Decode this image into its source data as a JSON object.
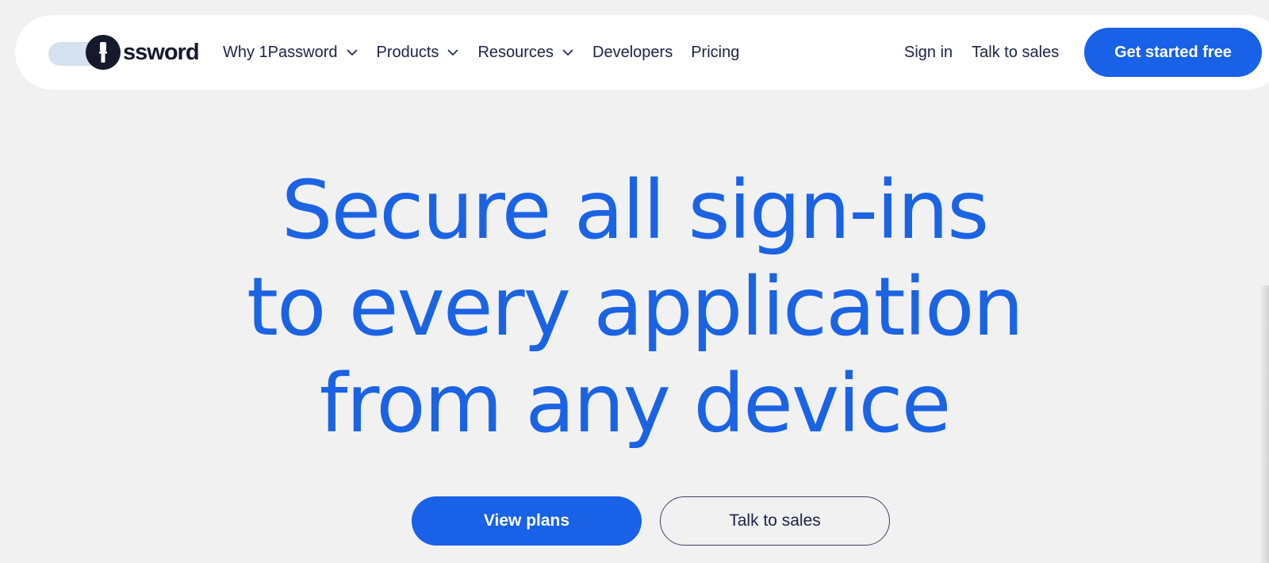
{
  "logo": {
    "text": "ssword",
    "icon": "keyhole-logo-icon"
  },
  "nav": {
    "items": [
      {
        "label": "Why 1Password",
        "has_dropdown": true,
        "icon": "chevron-down-icon"
      },
      {
        "label": "Products",
        "has_dropdown": true,
        "icon": "chevron-down-icon"
      },
      {
        "label": "Resources",
        "has_dropdown": true,
        "icon": "chevron-down-icon"
      },
      {
        "label": "Developers",
        "has_dropdown": false
      },
      {
        "label": "Pricing",
        "has_dropdown": false
      }
    ],
    "sign_in": "Sign in",
    "talk_to_sales": "Talk to sales",
    "cta": "Get started free"
  },
  "hero": {
    "lines": [
      "Secure all sign-ins",
      "to every application",
      "from any device"
    ],
    "primary_button": "View plans",
    "secondary_button": "Talk to sales"
  },
  "colors": {
    "brand_blue": "#1961e6",
    "headline_blue": "#1c63e3",
    "background": "#f1f1f2",
    "nav_text": "#1b2342"
  }
}
